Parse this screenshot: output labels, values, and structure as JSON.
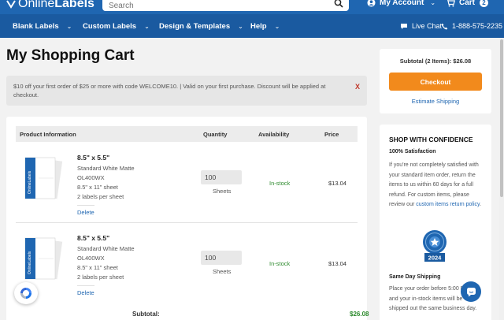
{
  "header": {
    "logo_part1": "Online",
    "logo_part2": "Labels",
    "search_placeholder": "Search",
    "account_label": "My Account",
    "cart_label": "Cart",
    "cart_count": "2"
  },
  "nav": {
    "items": [
      {
        "label": "Blank Labels"
      },
      {
        "label": "Custom Labels"
      },
      {
        "label": "Design & Templates"
      },
      {
        "label": "Help"
      }
    ],
    "live_chat": "Live Chat",
    "phone": "1-888-575-2235"
  },
  "page": {
    "title": "My Shopping Cart",
    "promo_text": "$10 off your first order of $25 or more with code WELCOME10. | Valid on your first purchase. Discount will be applied at checkout.",
    "promo_close": "X"
  },
  "table": {
    "headers": [
      "Product Information",
      "Quantity",
      "Availability",
      "Price"
    ],
    "rows": [
      {
        "name": "8.5\" x 5.5\"",
        "material": "Standard White Matte",
        "sku": "OL400WX",
        "sheet": "8.5\" x 11\" sheet",
        "per_sheet": "2 labels per sheet",
        "delete": "Delete",
        "quantity": "100",
        "unit": "Sheets",
        "availability": "In-stock",
        "price": "$13.04"
      },
      {
        "name": "8.5\" x 5.5\"",
        "material": "Standard White Matte",
        "sku": "OL400WX",
        "sheet": "8.5\" x 11\" sheet",
        "per_sheet": "2 labels per sheet",
        "delete": "Delete",
        "quantity": "100",
        "unit": "Sheets",
        "availability": "In-stock",
        "price": "$13.04"
      }
    ],
    "subtotal_label": "Subtotal:",
    "subtotal_value": "$26.08"
  },
  "sidebar": {
    "subtotal": "Subtotal (2 Items): $26.08",
    "checkout": "Checkout",
    "estimate_shipping": "Estimate Shipping",
    "confidence_title": "SHOP WITH CONFIDENCE",
    "satisfaction_title": "100% Satisfaction",
    "satisfaction_text": "If you're not completely satisfied with your standard item order, return the items to us within 60 days for a full refund. For custom items, please review our ",
    "satisfaction_link": "custom items return policy",
    "satisfaction_end": ".",
    "badge_year": "2024",
    "sameday_title": "Same Day Shipping",
    "sameday_text": "Place your order before 5:00 PM ET and your in-stock items will be shipped out the same business day."
  },
  "colors": {
    "header_blue": "#1f66b1",
    "nav_blue": "#1a5aa0",
    "checkout_orange": "#f28a1c",
    "instock_green": "#2e8b2e"
  }
}
